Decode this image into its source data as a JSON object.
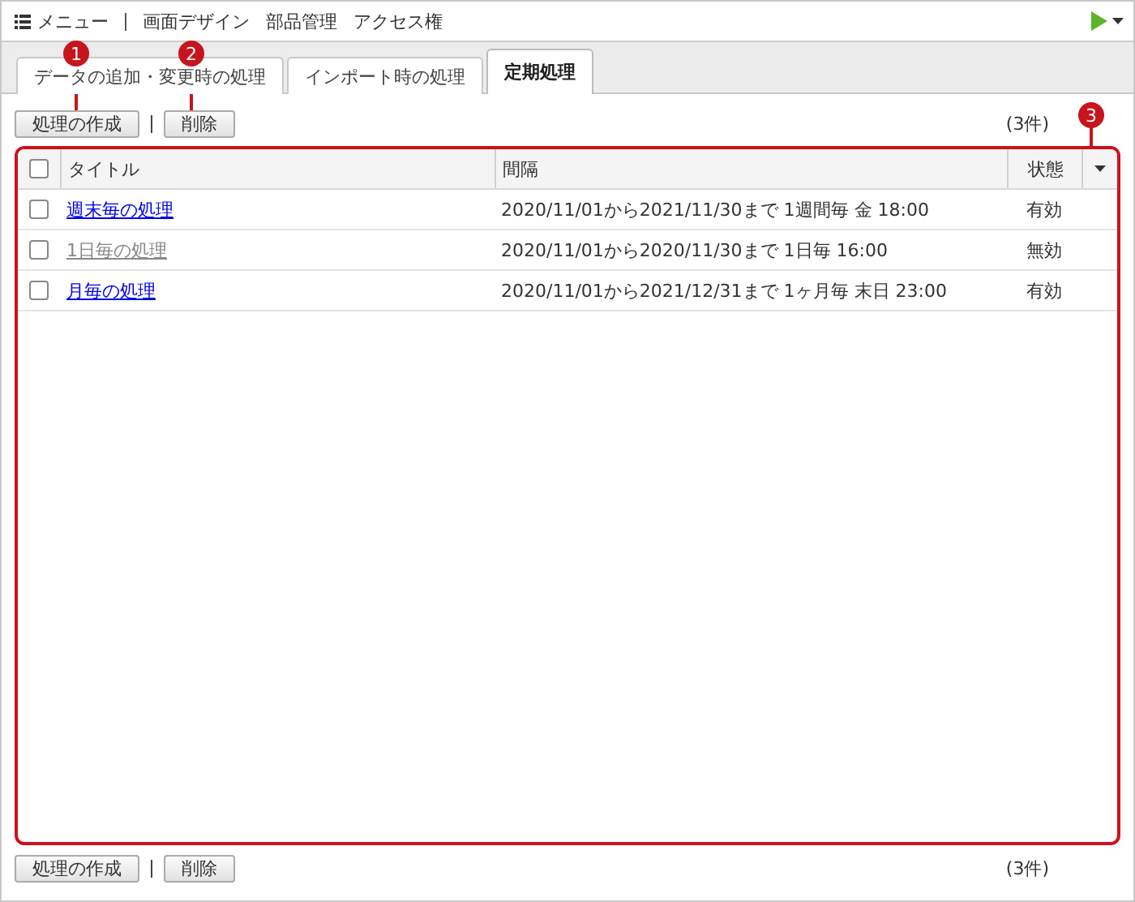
{
  "menu_bar": {
    "menu_label": "メニュー",
    "items": [
      "画面デザイン",
      "部品管理",
      "アクセス権"
    ]
  },
  "tabs": [
    {
      "label": "データの追加・変更時の処理",
      "selected": false
    },
    {
      "label": "インポート時の処理",
      "selected": false
    },
    {
      "label": "定期処理",
      "selected": true
    }
  ],
  "top_toolbar": {
    "buttons": [
      "処理の作成",
      "削除"
    ],
    "count": "(3件)"
  },
  "table": {
    "header_checked": false,
    "columns": [
      "タイトル",
      "間隔",
      "状態"
    ],
    "rows": [
      {
        "checked": false,
        "disabled": false,
        "title": "週末毎の処理",
        "interval": "2020/11/01から2021/11/30まで 1週間毎 金 18:00",
        "status": "有効"
      },
      {
        "checked": false,
        "disabled": true,
        "title": "1日毎の処理",
        "interval": "2020/11/01から2020/11/30まで 1日毎 16:00",
        "status": "無効"
      },
      {
        "checked": false,
        "disabled": false,
        "title": "月毎の処理",
        "interval": "2020/11/01から2021/12/31まで 1ヶ月毎 末日 23:00",
        "status": "有効"
      }
    ]
  },
  "bottom_toolbar": {
    "buttons": [
      "処理の作成",
      "削除"
    ],
    "count": "(3件)"
  },
  "callouts": [
    "1",
    "2",
    "3"
  ]
}
